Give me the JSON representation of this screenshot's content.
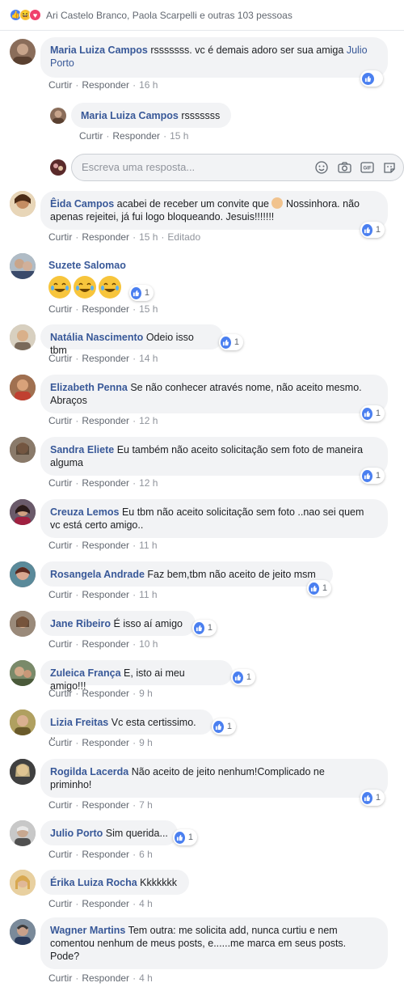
{
  "reactions_summary": {
    "text": "Ari Castelo Branco, Paola Scarpelli e outras 103 pessoas",
    "icons": [
      "like-icon",
      "haha-icon",
      "love-icon"
    ]
  },
  "actions": {
    "like": "Curtir",
    "reply": "Responder",
    "separator": "·"
  },
  "reply_input": {
    "placeholder": "Escreva uma resposta..."
  },
  "comments": [
    {
      "author": "Maria Luiza Campos",
      "text": "rsssssss. vc é demais adoro ser sua amiga",
      "mention": "Julio Porto",
      "time": "16 h",
      "likes": ""
    },
    {
      "author": "Maria Luiza Campos",
      "text": "rsssssss",
      "time": "15 h"
    },
    {
      "author": "Êida Campos",
      "text": "acabei de receber um convite que",
      "text2": "Nossinhora. não apenas rejeitei, já fui logo bloqueando. Jesuis!!!!!!!",
      "time": "15 h",
      "edited": "Editado",
      "likes": "1"
    },
    {
      "author": "Suzete Salomao",
      "time": "15 h",
      "likes": "1"
    },
    {
      "author": "Natália Nascimento",
      "text": "Odeio isso tbm",
      "time": "14 h",
      "likes": "1"
    },
    {
      "author": "Elizabeth Penna",
      "text": "Se não conhecer através nome, não aceito mesmo.",
      "text2": "Abraços",
      "time": "12 h",
      "likes": "1"
    },
    {
      "author": "Sandra Eliete",
      "text": "Eu também não aceito solicitação sem foto de maneira",
      "text2": "alguma",
      "time": "12 h",
      "likes": "1"
    },
    {
      "author": "Creuza Lemos",
      "text": "Eu tbm não aceito solicitação sem foto ..nao sei quem",
      "text2": "vc está certo amigo..",
      "time": "11 h"
    },
    {
      "author": "Rosangela Andrade",
      "text": "Faz bem,tbm não aceito de jeito msm",
      "time": "11 h",
      "likes": "1"
    },
    {
      "author": "Jane Ribeiro",
      "text": "É isso aí amigo",
      "time": "10 h",
      "likes": "1"
    },
    {
      "author": "Zuleica França",
      "text": "E, isto ai meu amigo!!!",
      "time": "9 h",
      "likes": "1"
    },
    {
      "author": "Lizia Freitas",
      "text": "Vc esta certissimo. ..",
      "time": "9 h",
      "likes": "1"
    },
    {
      "author": "Rogilda Lacerda",
      "text": "Não aceito de jeito nenhum!Complicado ne",
      "text2": "priminho!",
      "time": "7 h",
      "likes": "1"
    },
    {
      "author": "Julio Porto",
      "text": "Sim querida...",
      "time": "6 h",
      "likes": "1"
    },
    {
      "author": "Érika Luiza Rocha",
      "text": "Kkkkkkk",
      "time": "4 h"
    },
    {
      "author": "Wagner Martins",
      "text": "Tem outra: me solicita add, nunca curtiu e nem",
      "text2": "comentou nenhum de meus posts, e......me marca em seus posts.",
      "text3": "Pode?",
      "time": "4 h"
    }
  ],
  "colors": {
    "author": "#385898",
    "bubble": "#f2f3f5",
    "like_blue": "#4a7ff0",
    "haha_yellow": "#f7c53c",
    "love_red": "#f0416c",
    "meta_gray": "#616770"
  }
}
